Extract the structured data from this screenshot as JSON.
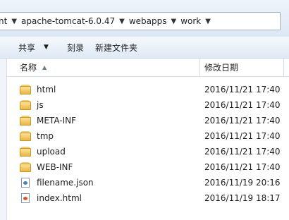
{
  "breadcrumb": [
    "nt",
    "apache-tomcat-6.0.47",
    "webapps",
    "work"
  ],
  "toolbar": {
    "share": "共享",
    "burn": "刻录",
    "new_folder": "新建文件夹"
  },
  "columns": {
    "name": "名称",
    "date": "修改日期"
  },
  "files": [
    {
      "name": "html",
      "date": "2016/11/21 17:40",
      "icon": "folder-icon"
    },
    {
      "name": "js",
      "date": "2016/11/21 17:40",
      "icon": "folder-icon"
    },
    {
      "name": "META-INF",
      "date": "2016/11/21 17:40",
      "icon": "folder-icon"
    },
    {
      "name": "tmp",
      "date": "2016/11/21 17:40",
      "icon": "folder-icon"
    },
    {
      "name": "upload",
      "date": "2016/11/21 17:40",
      "icon": "folder-icon"
    },
    {
      "name": "WEB-INF",
      "date": "2016/11/21 17:40",
      "icon": "folder-icon"
    },
    {
      "name": "filename.json",
      "date": "2016/11/19 20:16",
      "icon": "json-file-icon"
    },
    {
      "name": "index.html",
      "date": "2016/11/19 18:17",
      "icon": "html-file-icon"
    }
  ]
}
